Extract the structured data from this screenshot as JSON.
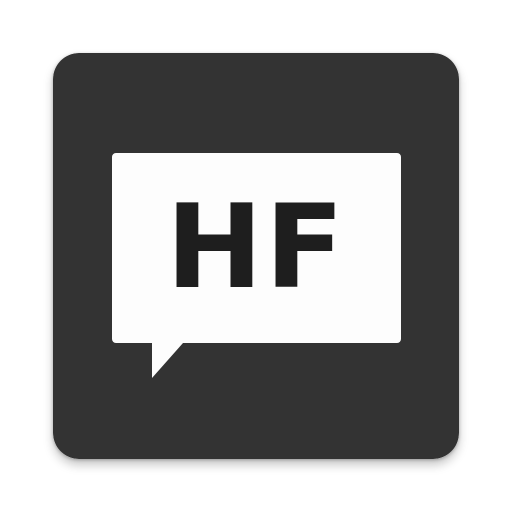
{
  "app_icon": {
    "name": "HF",
    "monogram": "HF",
    "icon": "speech-bubble-icon",
    "colors": {
      "tile": "#333333",
      "bubble": "#fdfdfd",
      "text": "#1e1e1e"
    }
  }
}
